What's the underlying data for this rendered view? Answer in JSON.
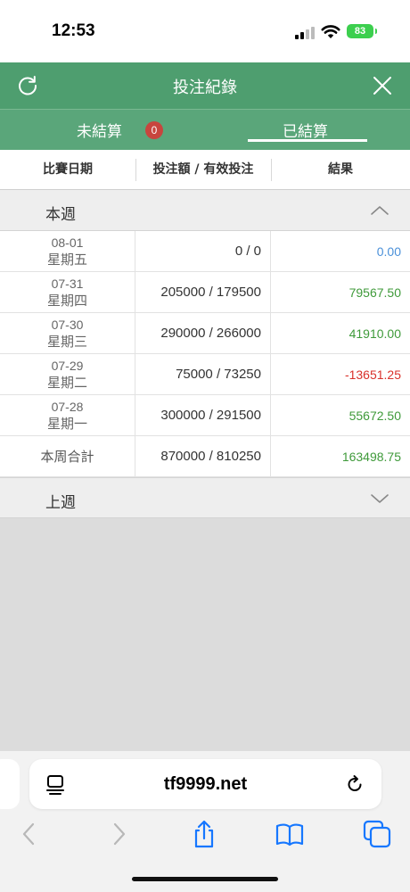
{
  "status_bar": {
    "time": "12:53",
    "battery": "83"
  },
  "header": {
    "title": "投注紀錄"
  },
  "tabs": [
    {
      "label": "未結算",
      "badge": "0"
    },
    {
      "label": "已結算"
    }
  ],
  "columns": [
    "比賽日期",
    "投注額 / 有效投注",
    "結果"
  ],
  "this_week": {
    "label": "本週",
    "rows": [
      {
        "date": "08-01",
        "weekday": "星期五",
        "stake": "0 / 0",
        "result": "0.00",
        "result_color": "#4a90d9"
      },
      {
        "date": "07-31",
        "weekday": "星期四",
        "stake": "205000 / 179500",
        "result": "79567.50",
        "result_color": "#3f9a3a"
      },
      {
        "date": "07-30",
        "weekday": "星期三",
        "stake": "290000 / 266000",
        "result": "41910.00",
        "result_color": "#3f9a3a"
      },
      {
        "date": "07-29",
        "weekday": "星期二",
        "stake": "75000 / 73250",
        "result": "-13651.25",
        "result_color": "#d9312b"
      },
      {
        "date": "07-28",
        "weekday": "星期一",
        "stake": "300000 / 291500",
        "result": "55672.50",
        "result_color": "#3f9a3a"
      }
    ],
    "total": {
      "label": "本周合計",
      "stake": "870000 / 810250",
      "result": "163498.75",
      "result_color": "#3f9a3a"
    }
  },
  "last_week": {
    "label": "上週"
  },
  "browser": {
    "url": "tf9999.net"
  },
  "colors": {
    "header_green": "#4e9e6f",
    "tab_green": "#5aa67a",
    "badge_red": "#c8453e"
  }
}
